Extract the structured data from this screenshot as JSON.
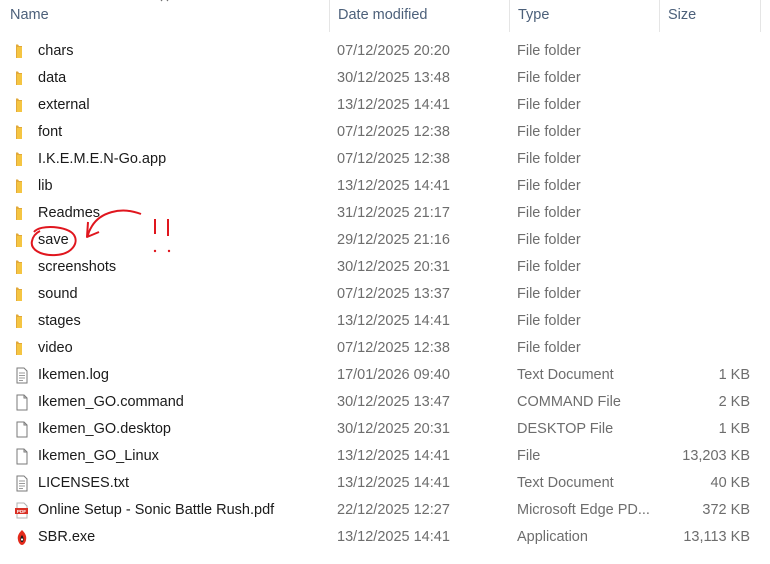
{
  "header": {
    "name": "Name",
    "date_modified": "Date modified",
    "type": "Type",
    "size": "Size"
  },
  "files": [
    {
      "name": "chars",
      "date": "07/12/2025 20:20",
      "type": "File folder",
      "size": "",
      "icon": "folder-icon"
    },
    {
      "name": "data",
      "date": "30/12/2025 13:48",
      "type": "File folder",
      "size": "",
      "icon": "folder-icon"
    },
    {
      "name": "external",
      "date": "13/12/2025 14:41",
      "type": "File folder",
      "size": "",
      "icon": "folder-icon"
    },
    {
      "name": "font",
      "date": "07/12/2025 12:38",
      "type": "File folder",
      "size": "",
      "icon": "folder-icon"
    },
    {
      "name": "I.K.E.M.E.N-Go.app",
      "date": "07/12/2025 12:38",
      "type": "File folder",
      "size": "",
      "icon": "folder-icon"
    },
    {
      "name": "lib",
      "date": "13/12/2025 14:41",
      "type": "File folder",
      "size": "",
      "icon": "folder-icon"
    },
    {
      "name": "Readmes",
      "date": "31/12/2025 21:17",
      "type": "File folder",
      "size": "",
      "icon": "folder-icon"
    },
    {
      "name": "save",
      "date": "29/12/2025 21:16",
      "type": "File folder",
      "size": "",
      "icon": "folder-icon"
    },
    {
      "name": "screenshots",
      "date": "30/12/2025 20:31",
      "type": "File folder",
      "size": "",
      "icon": "folder-icon"
    },
    {
      "name": "sound",
      "date": "07/12/2025 13:37",
      "type": "File folder",
      "size": "",
      "icon": "folder-icon"
    },
    {
      "name": "stages",
      "date": "13/12/2025 14:41",
      "type": "File folder",
      "size": "",
      "icon": "folder-icon"
    },
    {
      "name": "video",
      "date": "07/12/2025 12:38",
      "type": "File folder",
      "size": "",
      "icon": "folder-icon"
    },
    {
      "name": "Ikemen.log",
      "date": "17/01/2026 09:40",
      "type": "Text Document",
      "size": "1 KB",
      "icon": "text-document-icon"
    },
    {
      "name": "Ikemen_GO.command",
      "date": "30/12/2025 13:47",
      "type": "COMMAND File",
      "size": "2 KB",
      "icon": "file-icon"
    },
    {
      "name": "Ikemen_GO.desktop",
      "date": "30/12/2025 20:31",
      "type": "DESKTOP File",
      "size": "1 KB",
      "icon": "file-icon"
    },
    {
      "name": "Ikemen_GO_Linux",
      "date": "13/12/2025 14:41",
      "type": "File",
      "size": "13,203 KB",
      "icon": "file-icon"
    },
    {
      "name": "LICENSES.txt",
      "date": "13/12/2025 14:41",
      "type": "Text Document",
      "size": "40 KB",
      "icon": "text-document-icon"
    },
    {
      "name": "Online Setup - Sonic Battle Rush.pdf",
      "date": "22/12/2025 12:27",
      "type": "Microsoft Edge PD...",
      "size": "372 KB",
      "icon": "pdf-icon"
    },
    {
      "name": "SBR.exe",
      "date": "13/12/2025 14:41",
      "type": "Application",
      "size": "13,113 KB",
      "icon": "application-icon"
    }
  ],
  "colors": {
    "folder": "#f5c542",
    "header_text": "#4c607a",
    "annotation": "#e0161e"
  }
}
